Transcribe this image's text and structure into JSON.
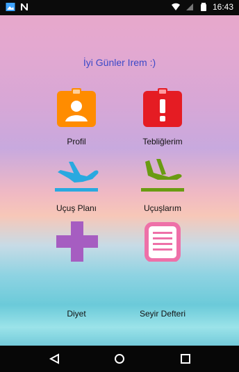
{
  "status": {
    "time": "16:43"
  },
  "greeting": "İyi Günler Irem :)",
  "menu": [
    {
      "label": "Profil",
      "icon": "profile-badge-icon"
    },
    {
      "label": "Tebliğlerim",
      "icon": "alert-notice-icon"
    },
    {
      "label": "Uçuş Planı",
      "icon": "airplane-takeoff-icon"
    },
    {
      "label": "Uçuşlarım",
      "icon": "airplane-landing-icon"
    },
    {
      "label": "Diyet",
      "icon": "medical-cross-icon"
    },
    {
      "label": "Seyir Defteri",
      "icon": "logbook-icon"
    }
  ],
  "colors": {
    "profile": "#ff8c00",
    "alert": "#e51c23",
    "takeoff": "#29a9e0",
    "landing": "#6a9b12",
    "cross": "#a65dc1",
    "logbook": "#ee70a8",
    "greeting": "#3b49c7"
  }
}
